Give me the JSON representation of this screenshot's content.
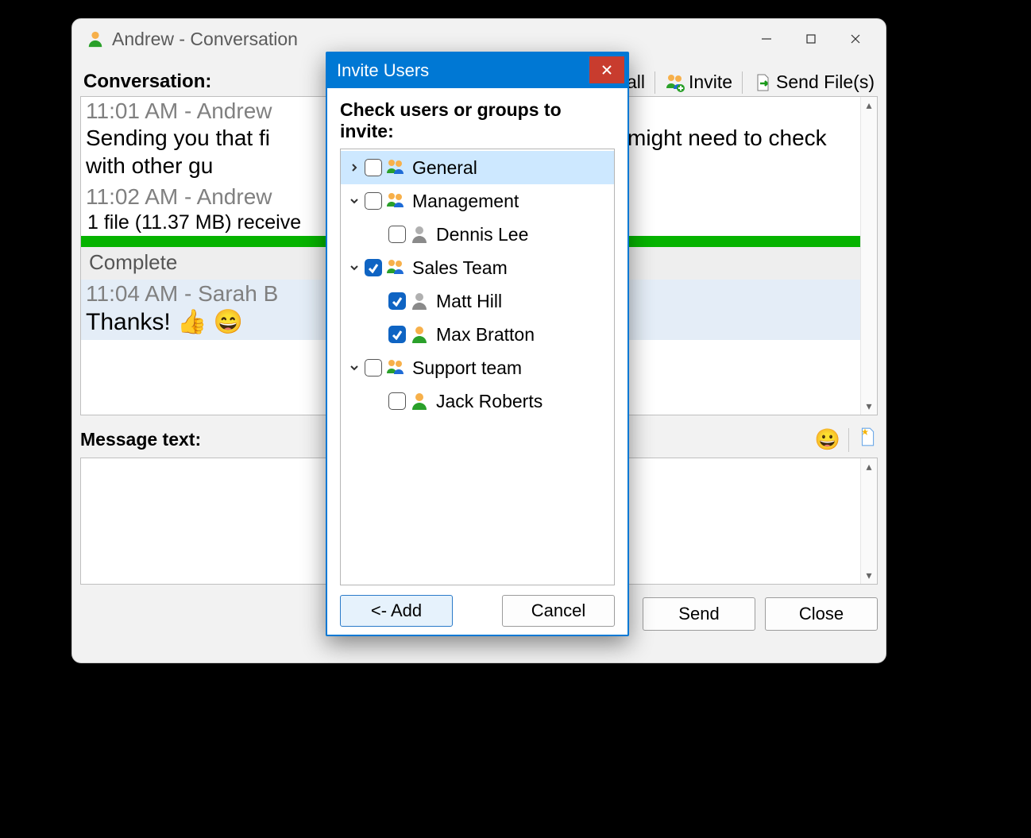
{
  "window": {
    "title": "Andrew - Conversation"
  },
  "labels": {
    "conversation_heading": "Conversation:",
    "message_text_heading": "Message text:"
  },
  "toolbar": {
    "call": "Call",
    "invite": "Invite",
    "send_files": "Send File(s)"
  },
  "messages": [
    {
      "meta": "11:01 AM - Andrew",
      "body_pre": "Sending you that fi",
      "body_post": "You might need to check with other gu"
    },
    {
      "meta": "11:02 AM - Andrew",
      "file_line": "1 file (11.37 MB) receive",
      "complete": "Complete"
    },
    {
      "meta": "11:04 AM - Sarah B",
      "body": "Thanks! 👍 😄"
    }
  ],
  "compose_placeholder": "",
  "buttons": {
    "send": "Send",
    "close": "Close"
  },
  "modal": {
    "title": "Invite Users",
    "instruction": "Check users or groups to invite:",
    "add": "<- Add",
    "cancel": "Cancel",
    "tree": [
      {
        "type": "group",
        "label": "General",
        "expanded": false,
        "checked": false,
        "selected": true
      },
      {
        "type": "group",
        "label": "Management",
        "expanded": true,
        "checked": false,
        "children": [
          {
            "label": "Dennis Lee",
            "checked": false,
            "gray": true
          }
        ]
      },
      {
        "type": "group",
        "label": "Sales Team",
        "expanded": true,
        "checked": true,
        "children": [
          {
            "label": "Matt Hill",
            "checked": true,
            "gray": true
          },
          {
            "label": "Max Bratton",
            "checked": true,
            "gray": false
          }
        ]
      },
      {
        "type": "group",
        "label": "Support team",
        "expanded": true,
        "checked": false,
        "children": [
          {
            "label": "Jack Roberts",
            "checked": false,
            "gray": false
          }
        ]
      }
    ]
  }
}
